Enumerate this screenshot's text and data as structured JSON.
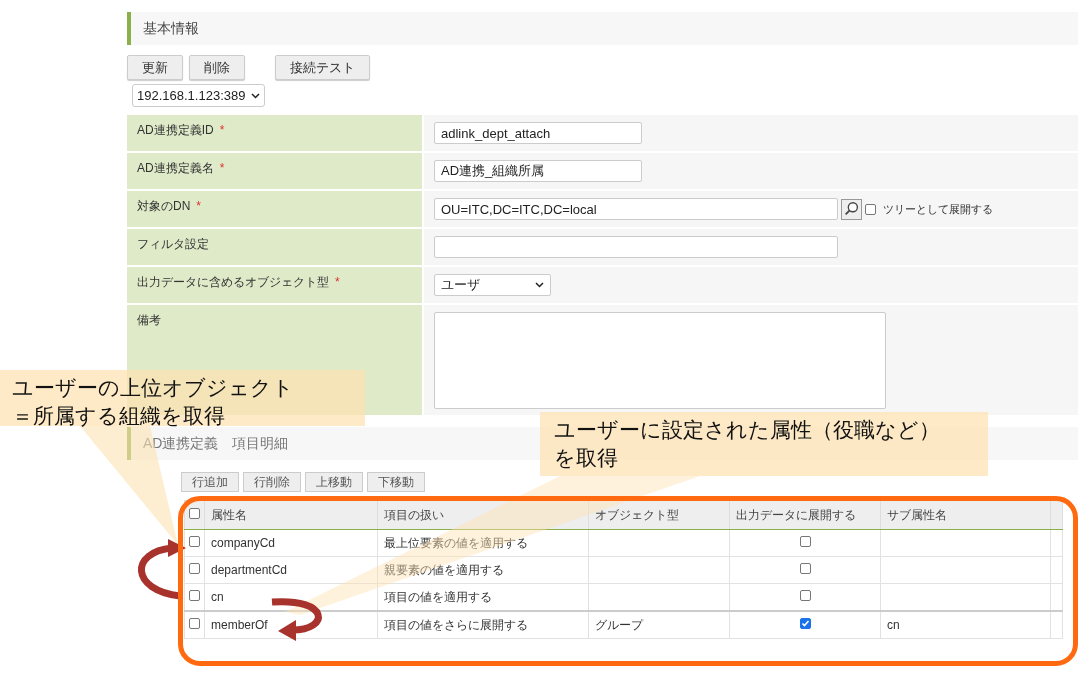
{
  "basic_section": {
    "title": "基本情報"
  },
  "action_buttons": [
    {
      "label": "更新"
    },
    {
      "label": "削除"
    },
    {
      "label": "接続テスト"
    }
  ],
  "server_select": {
    "value": "192.168.1.123:389"
  },
  "form_fields": [
    {
      "kind": "text",
      "label": "AD連携定義ID",
      "required_mark": "*",
      "value": "adlink_dept_attach"
    },
    {
      "kind": "text",
      "label": "AD連携定義名",
      "required_mark": "*",
      "value": "AD連携_組織所属"
    },
    {
      "kind": "dn",
      "label": "対象のDN",
      "required_mark": "*",
      "value": "OU=ITC,DC=ITC,DC=local",
      "option_label": "ツリーとして展開する",
      "option_checked": false
    },
    {
      "kind": "wide",
      "label": "フィルタ設定"
    },
    {
      "kind": "select",
      "label": "出力データに含めるオブジェクト型",
      "required_mark": "*",
      "value": "ユーザ"
    },
    {
      "kind": "textarea",
      "label": "備考"
    }
  ],
  "detail_section": {
    "title": "AD連携定義　項目明細"
  },
  "row_buttons": [
    {
      "label": "行追加"
    },
    {
      "label": "行削除"
    },
    {
      "label": "上移動"
    },
    {
      "label": "下移動"
    }
  ],
  "table": {
    "select_all_checked": false,
    "columns": [
      "属性名",
      "項目の扱い",
      "オブジェクト型",
      "出力データに展開する",
      "サブ属性名"
    ],
    "rows": [
      {
        "selected": false,
        "attribute": "companyCd",
        "handling": "最上位要素の値を適用する",
        "object_type": "",
        "expand": false,
        "sub_attribute": ""
      },
      {
        "selected": false,
        "attribute": "departmentCd",
        "handling": "親要素の値を適用する",
        "object_type": "",
        "expand": false,
        "sub_attribute": ""
      },
      {
        "selected": false,
        "attribute": "cn",
        "handling": "項目の値を適用する",
        "object_type": "",
        "expand": false,
        "sub_attribute": ""
      },
      {
        "selected": false,
        "attribute": "memberOf",
        "handling": "項目の値をさらに展開する",
        "object_type": "グループ",
        "expand": true,
        "sub_attribute": "cn"
      }
    ]
  },
  "annotations": [
    {
      "lines": [
        "ユーザーの上位オブジェクト",
        "＝所属する組織を取得"
      ]
    },
    {
      "lines": [
        "ユーザーに設定された属性（役職など）",
        "を取得"
      ]
    }
  ]
}
